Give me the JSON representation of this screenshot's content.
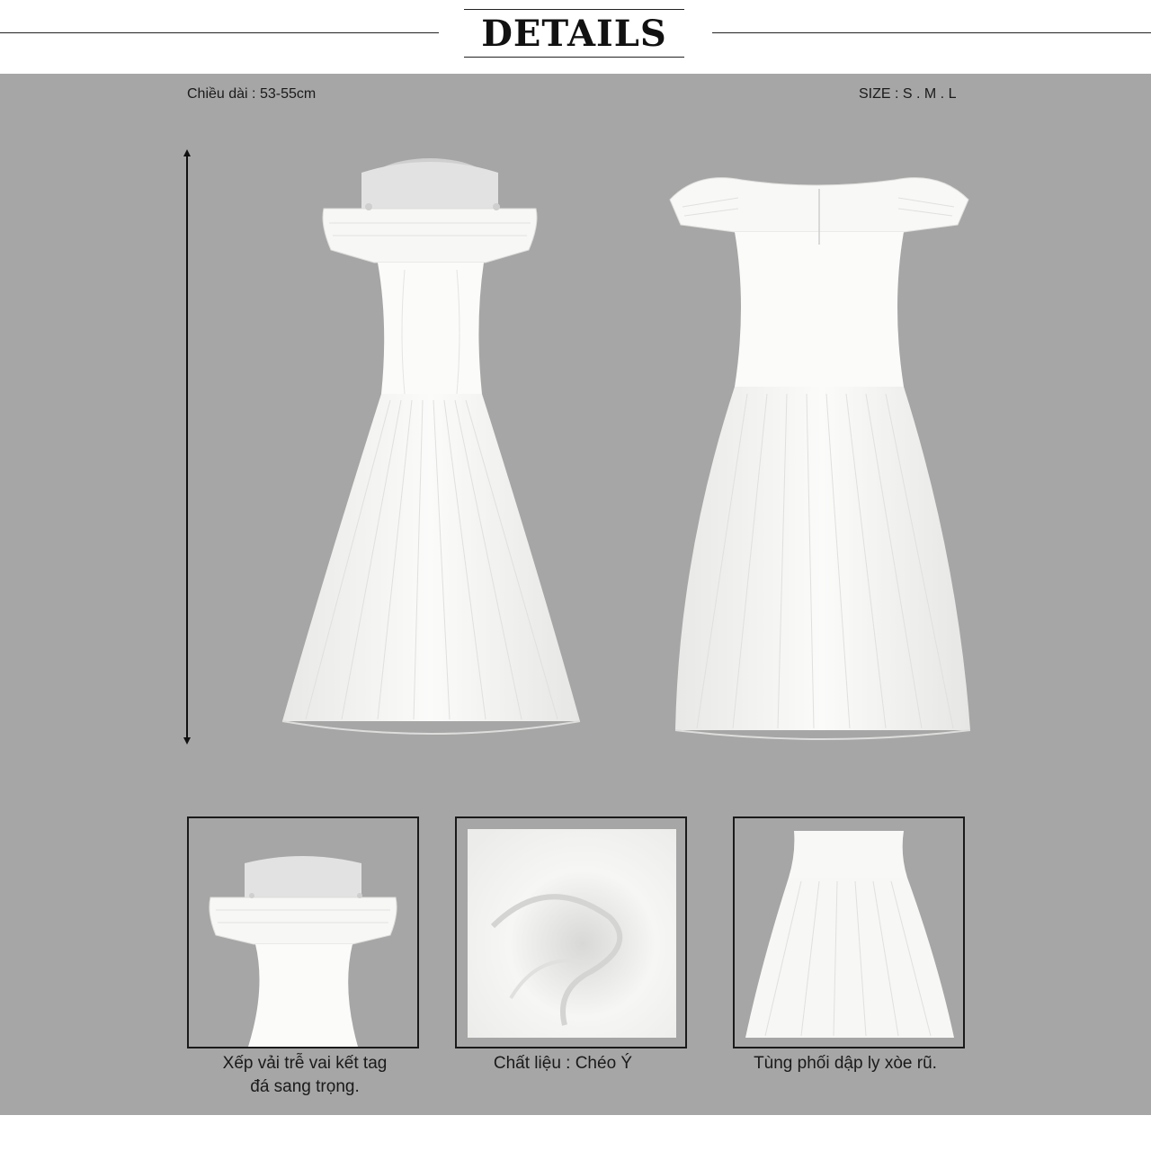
{
  "header": {
    "title": "DETAILS"
  },
  "specs": {
    "length_label": "Chiều dài : 53-55cm",
    "size_label": "SIZE : S . M . L"
  },
  "details": [
    {
      "caption_line1": "Xếp vải trễ vai kết tag",
      "caption_line2": "đá sang trọng."
    },
    {
      "caption_line1": "Chất liệu : Chéo Ý"
    },
    {
      "caption_line1": "Tùng phối dập ly xòe rũ."
    }
  ],
  "colors": {
    "panel_background": "#a6a6a6",
    "dress": "#fafaf8",
    "text": "#1a1a1a"
  }
}
